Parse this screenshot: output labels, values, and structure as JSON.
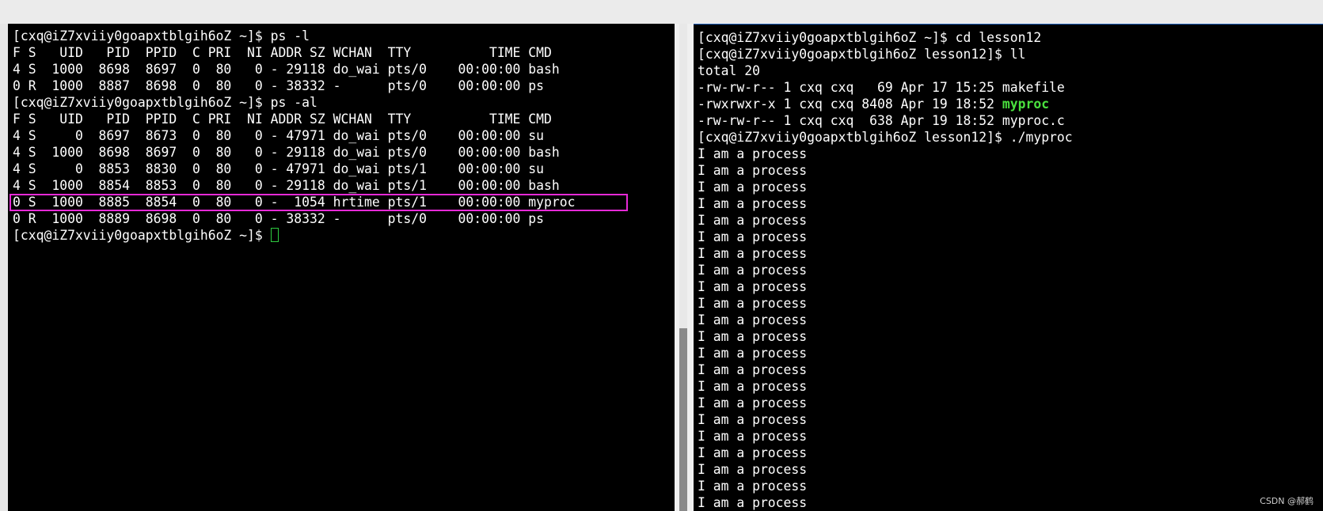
{
  "left_terminal": {
    "lines": [
      "[cxq@iZ7xviiy0goapxtblgih6oZ ~]$ ps -l",
      "F S   UID   PID  PPID  C PRI  NI ADDR SZ WCHAN  TTY          TIME CMD",
      "4 S  1000  8698  8697  0  80   0 - 29118 do_wai pts/0    00:00:00 bash",
      "0 R  1000  8887  8698  0  80   0 - 38332 -      pts/0    00:00:00 ps",
      "[cxq@iZ7xviiy0goapxtblgih6oZ ~]$ ps -al",
      "F S   UID   PID  PPID  C PRI  NI ADDR SZ WCHAN  TTY          TIME CMD",
      "4 S     0  8697  8673  0  80   0 - 47971 do_wai pts/0    00:00:00 su",
      "4 S  1000  8698  8697  0  80   0 - 29118 do_wai pts/0    00:00:00 bash",
      "4 S     0  8853  8830  0  80   0 - 47971 do_wai pts/1    00:00:00 su",
      "4 S  1000  8854  8853  0  80   0 - 29118 do_wai pts/1    00:00:00 bash",
      "0 S  1000  8885  8854  0  80   0 -  1054 hrtime pts/1    00:00:00 myproc",
      "0 R  1000  8889  8698  0  80   0 - 38332 -      pts/0    00:00:00 ps"
    ],
    "prompt": "[cxq@iZ7xviiy0goapxtblgih6oZ ~]$ "
  },
  "right_terminal": {
    "lines": [
      "[cxq@iZ7xviiy0goapxtblgih6oZ ~]$ cd lesson12",
      "[cxq@iZ7xviiy0goapxtblgih6oZ lesson12]$ ll",
      "total 20",
      "-rw-rw-r-- 1 cxq cxq   69 Apr 17 15:25 makefile"
    ],
    "exec_line_prefix": "-rwxrwxr-x 1 cxq cxq 8408 Apr 19 18:52 ",
    "exec_file": "myproc",
    "lines_after": [
      "-rw-rw-r-- 1 cxq cxq  638 Apr 19 18:52 myproc.c",
      "[cxq@iZ7xviiy0goapxtblgih6oZ lesson12]$ ./myproc"
    ],
    "output_line": "I am a process",
    "output_count": 22
  },
  "watermark": "CSDN @郝鹤",
  "colors": {
    "highlight_box": "#e629d6",
    "executable_green": "#4ae03e",
    "cursor": "#2ecc40"
  }
}
